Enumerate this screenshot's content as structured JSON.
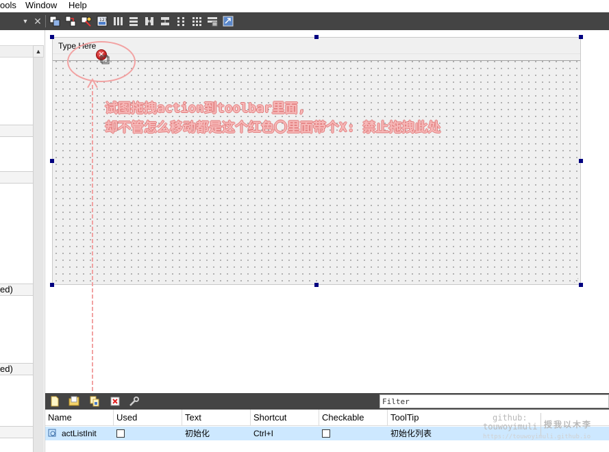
{
  "menubar": {
    "items": [
      "ools",
      "Window",
      "Help"
    ]
  },
  "toolbar": {
    "buttons": [
      {
        "icon": "edit-widgets-icon"
      },
      {
        "icon": "edit-signals-slots-icon"
      },
      {
        "icon": "edit-buddies-icon"
      },
      {
        "icon": "edit-tab-order-icon"
      },
      {
        "icon": "layout-horizontal-icon"
      },
      {
        "icon": "layout-vertical-icon"
      },
      {
        "icon": "layout-horizontal-splitter-icon"
      },
      {
        "icon": "layout-vertical-splitter-icon"
      },
      {
        "icon": "layout-form-icon"
      },
      {
        "icon": "layout-grid-icon"
      },
      {
        "icon": "break-layout-icon"
      },
      {
        "icon": "adjust-size-icon"
      }
    ]
  },
  "left_dock": {
    "sections": [
      "",
      "",
      "ed)",
      "ed)",
      ""
    ]
  },
  "form": {
    "menubar_placeholder": "Type Here"
  },
  "annotation": {
    "line1": "试图拖拽action到toolbar里面,",
    "line2": "却不管怎么移动都是这个红色〇里面带个X: 禁止拖拽此处",
    "color": "#f6b8b8"
  },
  "action_editor": {
    "toolbar_icons": [
      "new-action-icon",
      "open-folder-icon",
      "copy-action-icon",
      "delete-action-icon",
      "configure-wrench-icon"
    ],
    "filter_placeholder": "Filter",
    "columns": [
      "Name",
      "Used",
      "Text",
      "Shortcut",
      "Checkable",
      "ToolTip"
    ],
    "rows": [
      {
        "name": "actListInit",
        "used": false,
        "text": "初始化",
        "shortcut": "Ctrl+I",
        "checkable": false,
        "tooltip": "初始化列表"
      }
    ],
    "selection_color": "#cde8ff"
  },
  "watermark": {
    "line1": "github:",
    "line2": "touwoyimuli",
    "line3": "授我以木李",
    "line4": "https://touwoyimuli.github.io"
  }
}
